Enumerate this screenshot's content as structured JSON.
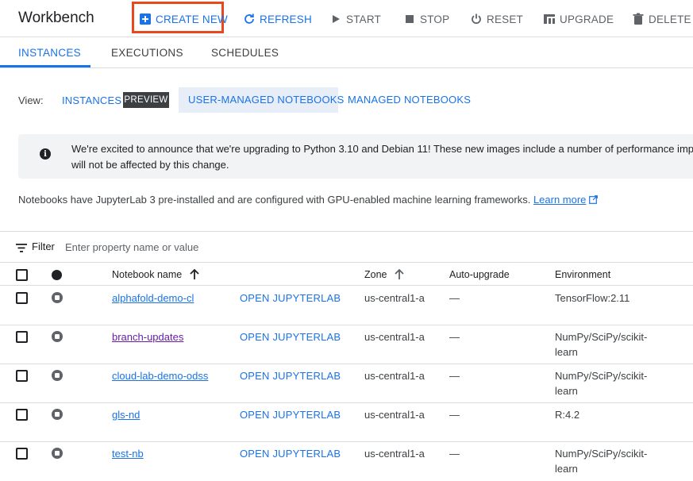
{
  "header": {
    "title": "Workbench",
    "actions": [
      {
        "label": "CREATE NEW",
        "icon": "add-box-icon"
      },
      {
        "label": "REFRESH",
        "icon": "refresh-icon"
      },
      {
        "label": "START",
        "icon": "play-icon"
      },
      {
        "label": "STOP",
        "icon": "stop-icon"
      },
      {
        "label": "RESET",
        "icon": "power-icon"
      },
      {
        "label": "UPGRADE",
        "icon": "upgrade-icon"
      },
      {
        "label": "DELETE",
        "icon": "trash-icon"
      }
    ]
  },
  "tabs": [
    {
      "label": "INSTANCES",
      "active": true
    },
    {
      "label": "EXECUTIONS",
      "active": false
    },
    {
      "label": "SCHEDULES",
      "active": false
    }
  ],
  "view": {
    "label": "View:",
    "instances": "INSTANCES",
    "preview_badge": "PREVIEW",
    "user_managed": "USER-MANAGED NOTEBOOKS",
    "managed": "MANAGED NOTEBOOKS"
  },
  "banner": {
    "icon": "info-icon",
    "line1": "We're excited to announce that we're upgrading to Python 3.10 and Debian 11! These new images include a number of performance impr",
    "line2": "will not be affected by this change."
  },
  "info": {
    "text": "Notebooks have JupyterLab 3 pre-installed and are configured with GPU-enabled machine learning frameworks.",
    "link": "Learn more"
  },
  "filter": {
    "label": "Filter",
    "placeholder": "Enter property name or value"
  },
  "table": {
    "columns": {
      "name": "Notebook name",
      "zone": "Zone",
      "auto_upgrade": "Auto-upgrade",
      "environment": "Environment"
    },
    "rows": [
      {
        "name": "alphafold-demo-cl",
        "action": "OPEN JUPYTERLAB",
        "zone": "us-central1-a",
        "auto_upgrade": "—",
        "environment": "TensorFlow:2.11"
      },
      {
        "name": "branch-updates",
        "action": "OPEN JUPYTERLAB",
        "zone": "us-central1-a",
        "auto_upgrade": "—",
        "environment": "NumPy/SciPy/scikit-learn"
      },
      {
        "name": "cloud-lab-demo-odss",
        "action": "OPEN JUPYTERLAB",
        "zone": "us-central1-a",
        "auto_upgrade": "—",
        "environment": "NumPy/SciPy/scikit-learn"
      },
      {
        "name": "gls-nd",
        "action": "OPEN JUPYTERLAB",
        "zone": "us-central1-a",
        "auto_upgrade": "—",
        "environment": "R:4.2"
      },
      {
        "name": "test-nb",
        "action": "OPEN JUPYTERLAB",
        "zone": "us-central1-a",
        "auto_upgrade": "—",
        "environment": "NumPy/SciPy/scikit-learn"
      }
    ]
  },
  "colors": {
    "accent": "#1a73e8",
    "highlight": "#e8481f",
    "visited_link": "#681da8"
  }
}
